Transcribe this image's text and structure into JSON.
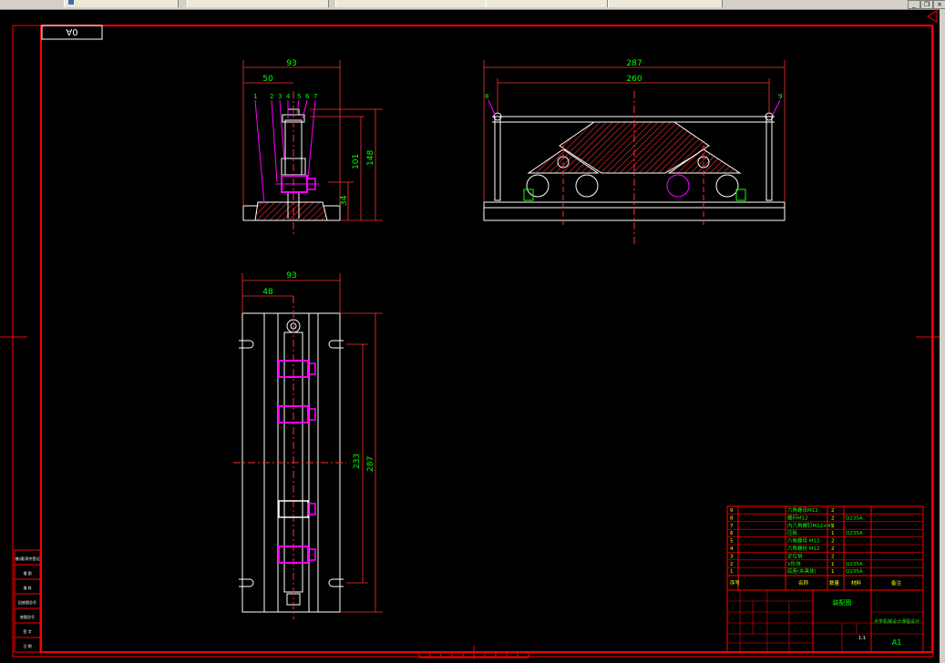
{
  "window": {
    "tabs": [
      {
        "label": ""
      },
      {
        "label": ""
      },
      {
        "label": ""
      },
      {
        "label": ""
      },
      {
        "label": ""
      }
    ],
    "controls": {
      "minimize": "_",
      "restore": "❐",
      "close": "×"
    }
  },
  "drawing": {
    "sheet_tag": "0A",
    "side_view": {
      "dim_total_width": "93",
      "dim_offset": "50",
      "part_numbers": [
        "1",
        "2",
        "3",
        "4",
        "5",
        "6",
        "7"
      ],
      "dim_height": "148",
      "dim_upper": "101",
      "dim_lower": "34"
    },
    "front_view": {
      "dim_overall": "287",
      "dim_inner": "260",
      "balloon_left": "8",
      "balloon_right": "9"
    },
    "plan_view": {
      "dim_width": "93",
      "dim_offset": "48",
      "dim_slot": "233",
      "dim_length": "287"
    },
    "bom": {
      "rows": [
        {
          "no": "9",
          "name": "六角螺母M12",
          "qty": "2",
          "material": ""
        },
        {
          "no": "8",
          "name": "螺杆M12",
          "qty": "2",
          "material": "Q235A"
        },
        {
          "no": "7",
          "name": "内六角螺钉M12×45",
          "qty": "2",
          "material": ""
        },
        {
          "no": "6",
          "name": "压板",
          "qty": "1",
          "material": "Q235A"
        },
        {
          "no": "5",
          "name": "六角螺母 M12",
          "qty": "2",
          "material": ""
        },
        {
          "no": "4",
          "name": "六角螺栓 M12",
          "qty": "2",
          "material": ""
        },
        {
          "no": "3",
          "name": "定位销",
          "qty": "2",
          "material": ""
        },
        {
          "no": "2",
          "name": "V形块",
          "qty": "1",
          "material": "Q235A"
        },
        {
          "no": "1",
          "name": "底座(夹具体)",
          "qty": "1",
          "material": "Q235A"
        }
      ],
      "header": {
        "no": "序号",
        "name": "名称",
        "qty": "数量",
        "material": "材料",
        "note": "备注"
      }
    },
    "title_block": {
      "drawing_name": "装配图",
      "school": "大学机械设计课程设计",
      "sheet_size": "A1",
      "scale": "1:1"
    },
    "left_strip": [
      "借(通)用件登记",
      "描 图",
      "描 校",
      "旧底图总号",
      "底图总号",
      "签 字",
      "日 期"
    ]
  },
  "colors": {
    "frame_red": "#ff0000",
    "outline_white": "#ffffff",
    "dimension_green": "#00ff00",
    "hatch_red": "#ff3030",
    "magenta": "#ff00ff",
    "cyan_text": "#00ffff"
  }
}
